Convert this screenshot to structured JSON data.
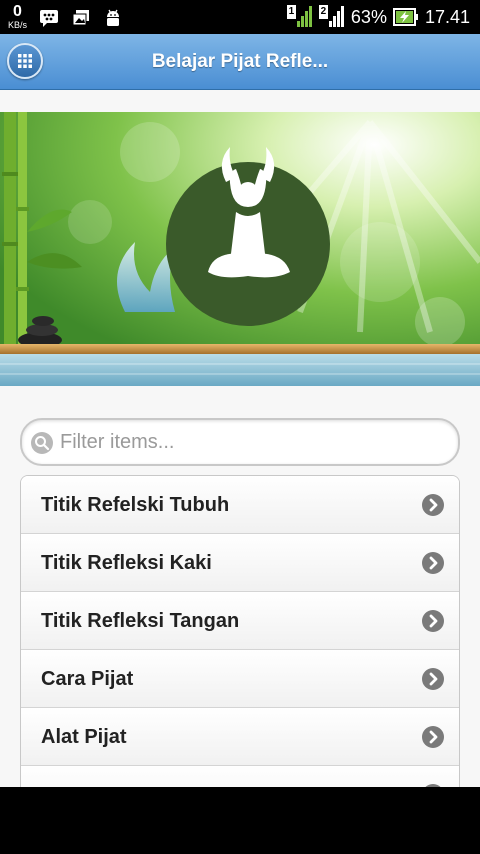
{
  "status_bar": {
    "speed_value": "0",
    "speed_unit": "KB/s",
    "left_icons": [
      "bbm-icon",
      "gallery-icon",
      "android-debug-icon"
    ],
    "sim1_badge": "1",
    "sim2_badge": "2",
    "battery_percent": "63%",
    "time": "17.41"
  },
  "header": {
    "title": "Belajar Pijat Refle...",
    "menu_icon": "grid-menu-icon"
  },
  "banner": {
    "logo_icon": "meditation-yoga-icon",
    "accent_green": "#3a5a2a"
  },
  "search": {
    "placeholder": "Filter items...",
    "value": ""
  },
  "menu": {
    "items": [
      {
        "label": "Titik Refelski Tubuh"
      },
      {
        "label": "Titik Refleksi Kaki"
      },
      {
        "label": "Titik Refleksi Tangan"
      },
      {
        "label": "Cara Pijat"
      },
      {
        "label": "Alat Pijat"
      },
      {
        "label": ""
      }
    ]
  },
  "colors": {
    "header_top": "#7eb5e6",
    "header_bottom": "#4a8ed3",
    "arrow_circle": "#7a7a7a"
  }
}
